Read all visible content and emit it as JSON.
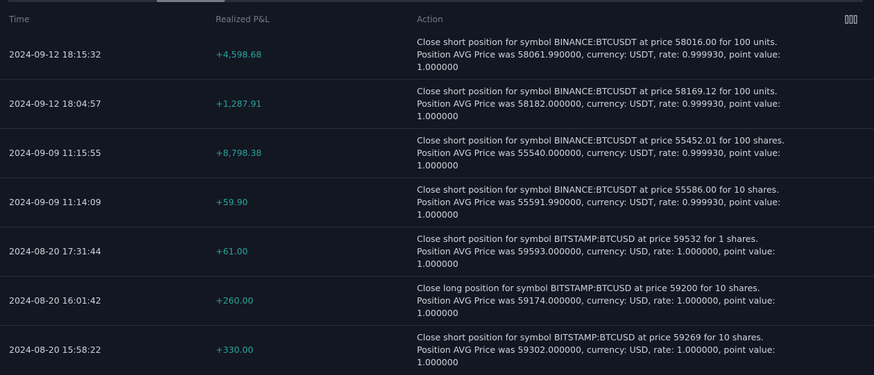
{
  "columns": {
    "time": "Time",
    "pnl": "Realized P&L",
    "action": "Action",
    "settings_icon": "columns-icon"
  },
  "rows": [
    {
      "time": "2024-09-12 18:15:32",
      "pnl": "+4,598.68",
      "action_lines": [
        "Close short position for symbol BINANCE:BTCUSDT at price 58016.00 for 100 units.",
        "Position AVG Price was 58061.990000, currency: USDT, rate: 0.999930, point value:",
        "1.000000"
      ]
    },
    {
      "time": "2024-09-12 18:04:57",
      "pnl": "+1,287.91",
      "action_lines": [
        "Close short position for symbol BINANCE:BTCUSDT at price 58169.12 for 100 units.",
        "Position AVG Price was 58182.000000, currency: USDT, rate: 0.999930, point value:",
        "1.000000"
      ]
    },
    {
      "time": "2024-09-09 11:15:55",
      "pnl": "+8,798.38",
      "action_lines": [
        "Close short position for symbol BINANCE:BTCUSDT at price 55452.01 for 100 shares.",
        "Position AVG Price was 55540.000000, currency: USDT, rate: 0.999930, point value:",
        "1.000000"
      ]
    },
    {
      "time": "2024-09-09 11:14:09",
      "pnl": "+59.90",
      "action_lines": [
        "Close short position for symbol BINANCE:BTCUSDT at price 55586.00 for 10 shares.",
        "Position AVG Price was 55591.990000, currency: USDT, rate: 0.999930, point value:",
        "1.000000"
      ]
    },
    {
      "time": "2024-08-20 17:31:44",
      "pnl": "+61.00",
      "action_lines": [
        "Close short position for symbol BITSTAMP:BTCUSD at price 59532 for 1 shares.",
        "Position AVG Price was 59593.000000, currency: USD, rate: 1.000000, point value:",
        "1.000000"
      ]
    },
    {
      "time": "2024-08-20 16:01:42",
      "pnl": "+260.00",
      "action_lines": [
        "Close long position for symbol BITSTAMP:BTCUSD at price 59200 for 10 shares.",
        "Position AVG Price was 59174.000000, currency: USD, rate: 1.000000, point value:",
        "1.000000"
      ]
    },
    {
      "time": "2024-08-20 15:58:22",
      "pnl": "+330.00",
      "action_lines": [
        "Close short position for symbol BITSTAMP:BTCUSD at price 59269 for 10 shares.",
        "Position AVG Price was 59302.000000, currency: USD, rate: 1.000000, point value:",
        "1.000000"
      ]
    }
  ],
  "colors": {
    "background": "#131722",
    "text": "#d1d4dc",
    "muted": "#787b86",
    "positive": "#26a69a",
    "divider": "#2a2e39"
  }
}
